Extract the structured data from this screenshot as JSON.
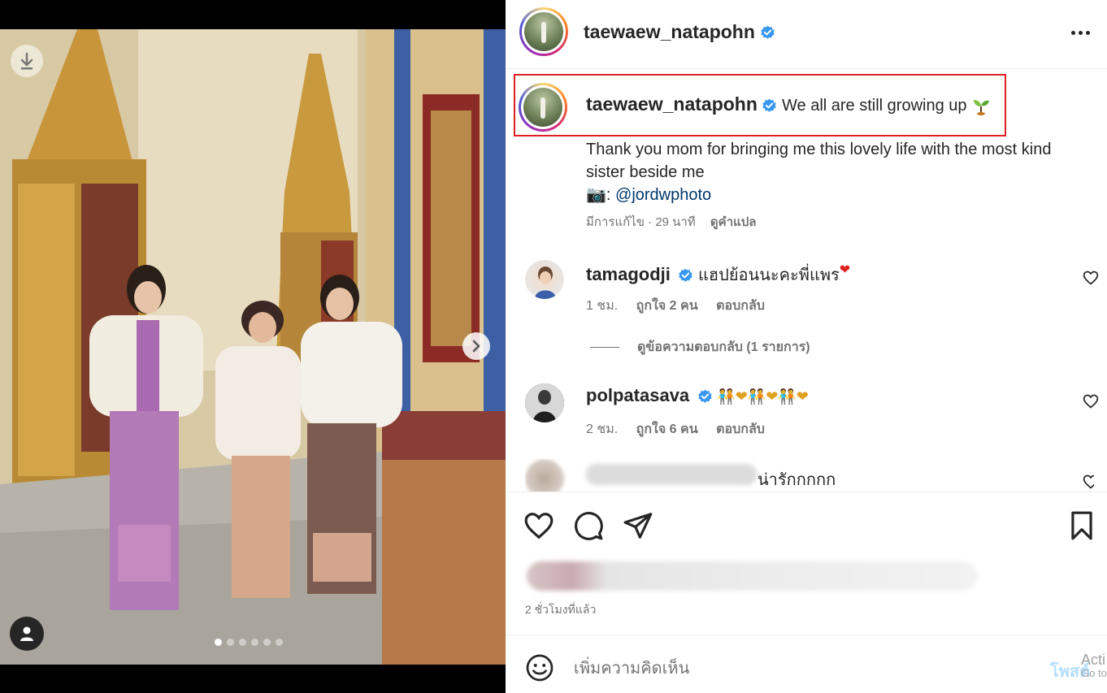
{
  "post": {
    "username": "taewaew_natapohn",
    "verified": true,
    "caption_title": "We all are still growing up",
    "caption_emoji": "seedling",
    "caption_body": "Thank you mom for bringing me this lovely life with the most kind sister beside me",
    "camera_emoji": "📷",
    "photo_credit_sep": ": ",
    "photo_credit": "@jordwphoto",
    "meta_edited": "มีการแก้ไข · 29 นาที",
    "meta_translate": "ดูคำแปล"
  },
  "comments": [
    {
      "username": "tamagodji",
      "verified": true,
      "text": "แฮปย้อนนะคะพี่แพร",
      "emoji": "❤",
      "time": "1 ชม.",
      "likes": "ถูกใจ 2 คน",
      "reply": "ตอบกลับ",
      "view_replies": "ดูข้อความตอบกลับ (1 รายการ)"
    },
    {
      "username": "polpatasava",
      "verified": true,
      "text": "",
      "emoji": "🧑‍🤝‍🧑❤🧑‍🤝‍🧑❤🧑‍🤝‍🧑❤",
      "time": "2 ชม.",
      "likes": "ถูกใจ 6 คน",
      "reply": "ตอบกลับ"
    },
    {
      "username": "",
      "text": "น่ารักกกกก"
    }
  ],
  "footer": {
    "time_ago": "2 ชั่วโมงที่แล้ว",
    "comment_placeholder": "เพิ่มความคิดเห็น",
    "post_label": "โพสต์",
    "watermark_line1": "Acti",
    "watermark_line2": "Go to"
  },
  "carousel": {
    "total": 6,
    "active": 0
  },
  "colors": {
    "verified_blue": "#3897f0",
    "highlight_red": "#e02020",
    "link_blue": "#00376b",
    "post_button": "#b2dffc"
  },
  "icons": [
    "download-icon",
    "chevron-right-icon",
    "user-tag-icon",
    "more-options-icon",
    "heart-icon",
    "comment-icon",
    "share-icon",
    "bookmark-icon",
    "emoji-icon",
    "verified-badge-icon"
  ]
}
